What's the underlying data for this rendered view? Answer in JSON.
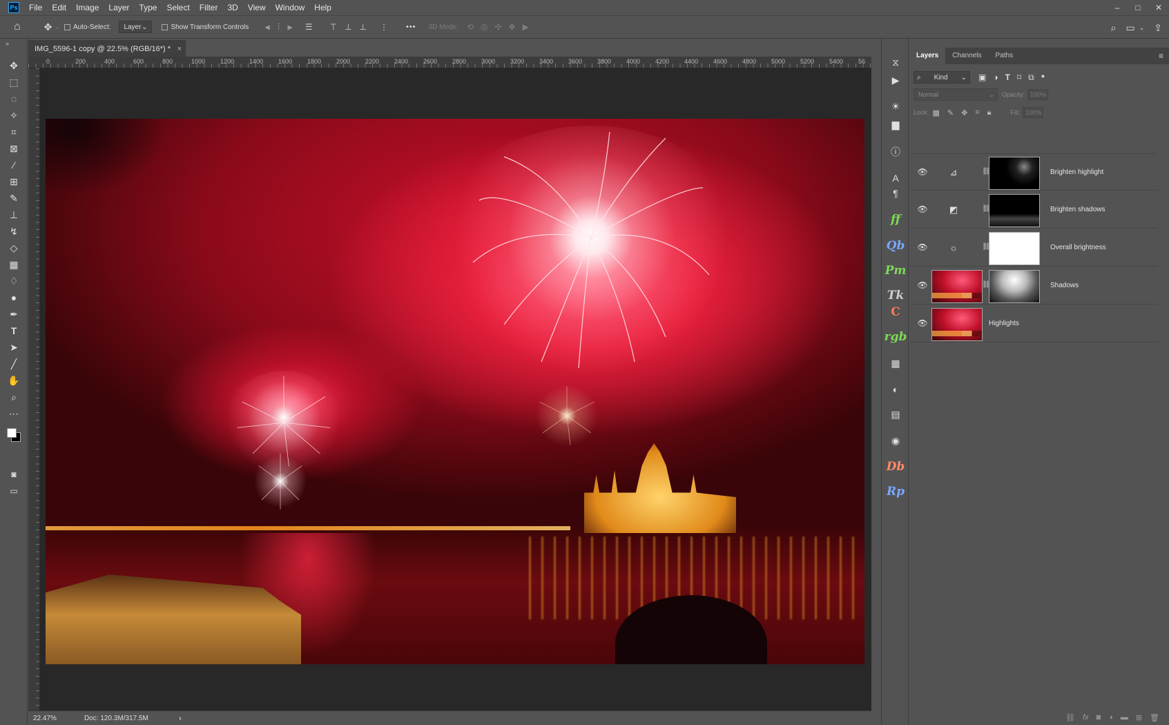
{
  "menu": [
    "File",
    "Edit",
    "Image",
    "Layer",
    "Type",
    "Select",
    "Filter",
    "3D",
    "View",
    "Window",
    "Help"
  ],
  "app_logo": "Ps",
  "window_controls": [
    "–",
    "□",
    "✕"
  ],
  "options": {
    "auto_select_label": "Auto-Select:",
    "auto_select_value": "Layer",
    "show_transform_label": "Show Transform Controls",
    "mode_3d_label": "3D Mode:",
    "more": "•••"
  },
  "document": {
    "tab_title": "IMG_5596-1 copy @ 22.5% (RGB/16*) *",
    "close": "×",
    "ruler_labels": [
      "0",
      "200",
      "400",
      "600",
      "800",
      "1000",
      "1200",
      "1400",
      "1600",
      "1800",
      "2000",
      "2200",
      "2400",
      "2600",
      "2800",
      "3000",
      "3200",
      "3400",
      "3600",
      "3800",
      "4000",
      "4200",
      "4400",
      "4600",
      "4800",
      "5000",
      "5200",
      "5400",
      "56"
    ]
  },
  "status": {
    "zoom": "22.47%",
    "doc_size": "Doc: 120.3M/317.5M",
    "arrow": "›"
  },
  "layers_panel": {
    "tabs": [
      "Layers",
      "Channels",
      "Paths"
    ],
    "active_tab": "Layers",
    "filter_kind": "Kind",
    "blend_mode": "Normal",
    "opacity_label": "Opacity:",
    "opacity_value": "100%",
    "lock_label": "Lock:",
    "fill_label": "Fill:",
    "fill_value": "100%",
    "layers": [
      {
        "name": "Brighten highlight",
        "type": "curves",
        "icon": "curves-icon"
      },
      {
        "name": "Brighten shadows",
        "type": "curves",
        "icon": "curves-adjust-icon"
      },
      {
        "name": "Overall brightness",
        "type": "brightness",
        "icon": "brightness-icon"
      },
      {
        "name": "Shadows",
        "type": "image-mask"
      },
      {
        "name": "Highlights",
        "type": "image"
      }
    ]
  },
  "strip_letters": {
    "ff": "ff",
    "qb": "Qb",
    "pm": "Pm",
    "tk": "Tk",
    "c": "C",
    "rgb": "rgb",
    "db": "Db",
    "rp": "Rp"
  },
  "colors": {
    "ui_bg": "#535353",
    "canvas_bg": "#282828",
    "accent_ps": "#31a8ff"
  }
}
